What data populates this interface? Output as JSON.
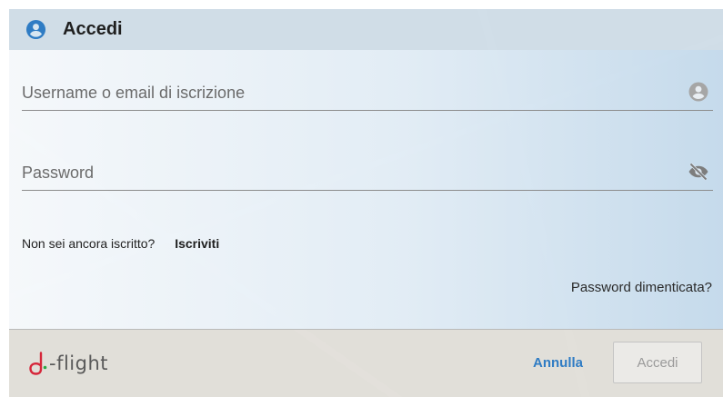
{
  "dialog": {
    "title": "Accedi",
    "title_icon": "account-circle-icon"
  },
  "form": {
    "username": {
      "placeholder": "Username o email di iscrizione",
      "value": "",
      "icon": "account-circle-icon"
    },
    "password": {
      "placeholder": "Password",
      "value": "",
      "icon": "eye-off-icon"
    },
    "signup_prompt": "Non sei ancora iscritto?",
    "signup_link": "Iscriviti",
    "forgot_password": "Password dimenticata?"
  },
  "footer": {
    "logo_text": "-flight",
    "cancel_label": "Annulla",
    "login_label": "Accedi"
  },
  "colors": {
    "accent_blue": "#2f7cc4",
    "logo_red": "#d6263a",
    "logo_green": "#2aa845"
  }
}
